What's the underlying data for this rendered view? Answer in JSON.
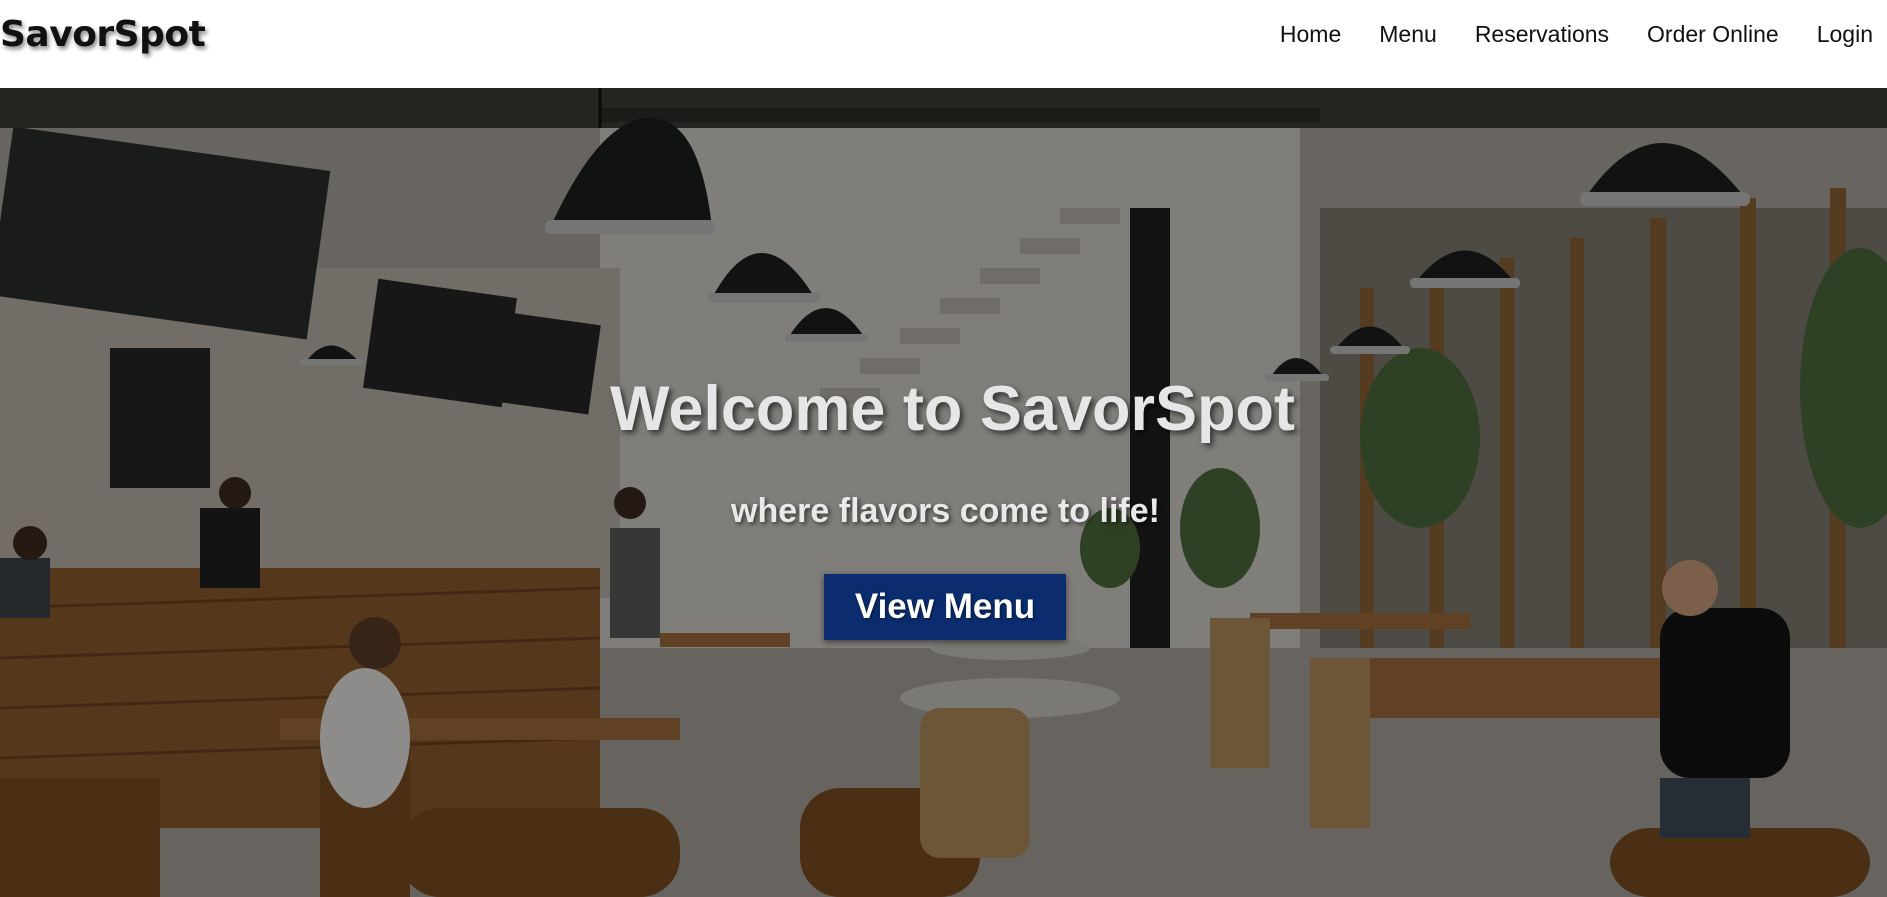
{
  "header": {
    "brand": "SavorSpot",
    "nav": [
      {
        "label": "Home"
      },
      {
        "label": "Menu"
      },
      {
        "label": "Reservations"
      },
      {
        "label": "Order Online"
      },
      {
        "label": "Login"
      }
    ]
  },
  "hero": {
    "title": "Welcome to SavorSpot",
    "subtitle": "where flavors come to life!",
    "cta_label": "View Menu",
    "cta_color": "#0b2d6f",
    "background": "cafe-interior-photo"
  }
}
